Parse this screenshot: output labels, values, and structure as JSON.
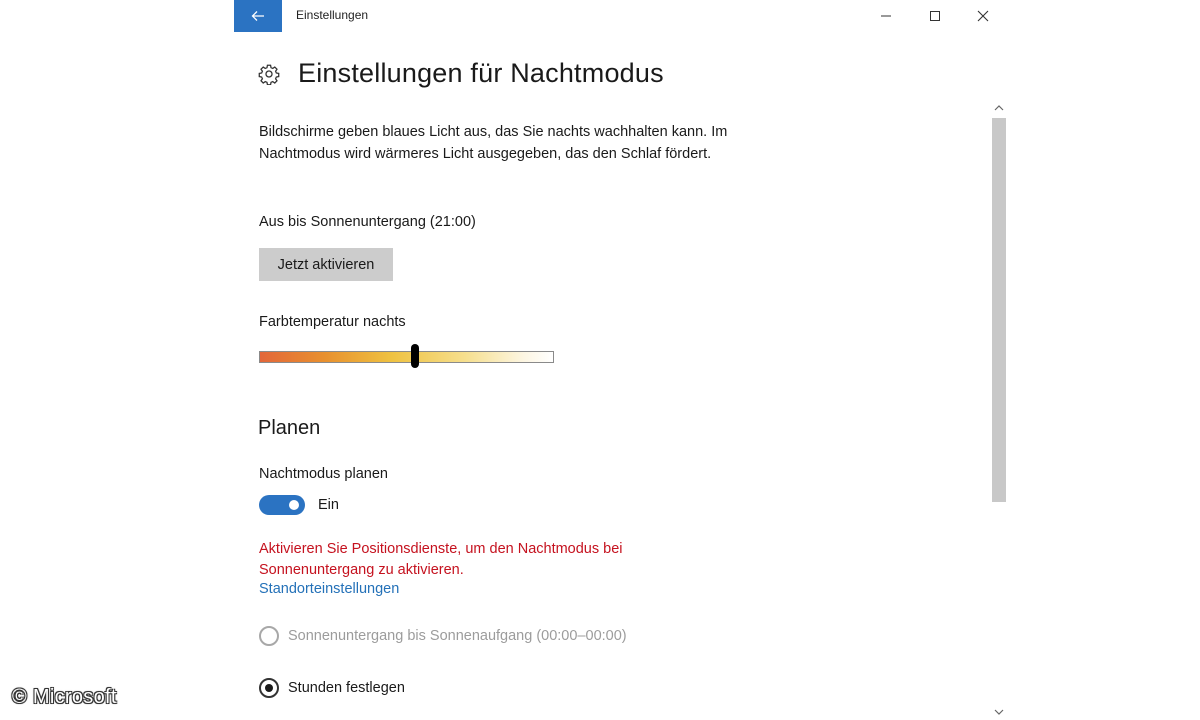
{
  "window": {
    "title": "Einstellungen",
    "accent_color": "#2b73c2"
  },
  "icons": {
    "back": "back-arrow-icon",
    "minimize": "minimize-icon",
    "maximize": "maximize-icon",
    "close": "close-icon",
    "page": "gear-icon"
  },
  "page": {
    "title": "Einstellungen für Nachtmodus",
    "description": "Bildschirme geben blaues Licht aus, das Sie nachts wachhalten kann. Im Nachtmodus wird wärmeres Licht ausgegeben, das den Schlaf fördert.",
    "status": "Aus bis Sonnenuntergang (21:00)",
    "activate_button": "Jetzt aktivieren",
    "color_temp_label": "Farbtemperatur nachts",
    "color_temp_level": 0.53
  },
  "schedule": {
    "section_title": "Planen",
    "toggle_label": "Nachtmodus planen",
    "toggle_on": true,
    "toggle_state": "Ein",
    "warning": "Aktivieren Sie Positionsdienste, um den Nachtmodus bei Sonnenuntergang zu aktivieren.",
    "warning_color": "#c5121f",
    "link": "Standorteinstellungen",
    "options": [
      {
        "label": "Sonnenuntergang bis Sonnenaufgang (00:00–00:00)",
        "selected": false,
        "disabled": true
      },
      {
        "label": "Stunden festlegen",
        "selected": true,
        "disabled": false
      }
    ]
  },
  "watermark": "© Microsoft"
}
